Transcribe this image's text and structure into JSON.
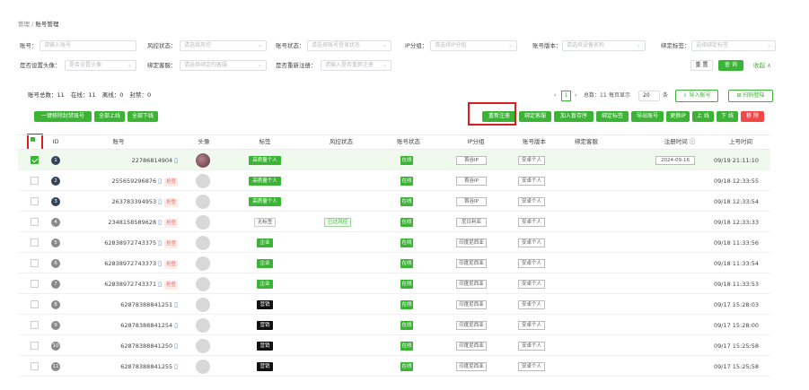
{
  "breadcrumb": {
    "parent": "管理",
    "sep": "/",
    "current": "账号管理"
  },
  "filters": {
    "account_label": "账号：",
    "account_placeholder": "请输入账号",
    "risk_label": "风控状态：",
    "risk_placeholder": "请选择风控",
    "acc_status_label": "账号状态：",
    "acc_status_placeholder": "请选择账号登录状态",
    "ip_label": "IP分组：",
    "ip_placeholder": "请选择IP分组",
    "version_label": "账号版本：",
    "version_placeholder": "请选择设备名称",
    "bind_tag_label": "绑定标签：",
    "bind_tag_placeholder": "选择绑定标签",
    "avatar_label": "是否设置头像：",
    "avatar_placeholder": "是否设置头像",
    "bind_cs_label": "绑定客服：",
    "bind_cs_placeholder": "请选择绑定的客服",
    "reregister_label": "是否重新注册：",
    "reregister_placeholder": "请输入是否重新注册",
    "reset": "重 置",
    "query": "查 询",
    "collapse": "收起 ∧"
  },
  "stats": {
    "total": "账号总数：11",
    "online": "在线：11",
    "offline": "离线：0",
    "banned": "封禁：0"
  },
  "pagination": {
    "prev": "‹",
    "page": "1",
    "next": "›",
    "total": "总数：11",
    "per_page_label": "每页显示",
    "per_page": "20",
    "unit": "条"
  },
  "top_actions": {
    "import": "导入账号",
    "sweep": "扫码登陆"
  },
  "left_actions": {
    "remove_banned": "一键移除封禁账号",
    "all_online": "全部上线",
    "all_offline": "全部下线"
  },
  "right_actions": {
    "reregister": "重新注册",
    "bind_cs": "绑定客服",
    "add_kw": "加入暂存序",
    "bind_tag": "绑定标签",
    "export": "导出账号",
    "change_ip": "更换IP",
    "online": "上 线",
    "offline": "下 线",
    "remove": "移 除"
  },
  "columns": {
    "id": "ID",
    "account": "账号",
    "avatar": "头像",
    "tag": "标签",
    "risk": "风控状态",
    "status": "账号状态",
    "ip": "IP分组",
    "version": "账号版本",
    "cs": "绑定客服",
    "regtime": "注册时间 ⓘ",
    "lastlogin": "上号时间"
  },
  "rows": [
    {
      "id": "1",
      "account": "22786814904",
      "warn": "",
      "tag": "高质量个人",
      "risk": "",
      "status": "在线",
      "ip": "首谷IP",
      "version": "安卓个人",
      "date": "2024-09-16",
      "time": "09/19 21:11:10"
    },
    {
      "id": "2",
      "account": "255659296876",
      "warn": "抢登",
      "tag": "高质量个人",
      "risk": "",
      "status": "在线",
      "ip": "首谷IP",
      "version": "安卓个人",
      "date": "",
      "time": "09/18 12:33:55"
    },
    {
      "id": "3",
      "account": "263783394953",
      "warn": "抢登",
      "tag": "高质量个人",
      "risk": "",
      "status": "在线",
      "ip": "首谷IP",
      "version": "安卓个人",
      "date": "",
      "time": "09/18 12:33:54"
    },
    {
      "id": "4",
      "account": "2348158589628",
      "warn": "抢登",
      "tag": "无标签",
      "risk": "已过风控",
      "status": "在线",
      "ip": "尼日利亚",
      "version": "安卓个人",
      "date": "",
      "time": "09/18 12:33:33"
    },
    {
      "id": "5",
      "account": "62838972743375",
      "warn": "抢登",
      "tag": "企业",
      "risk": "",
      "status": "在线",
      "ip": "印度尼西亚",
      "version": "安卓个人",
      "date": "",
      "time": "09/18 11:33:56"
    },
    {
      "id": "6",
      "account": "62838972743373",
      "warn": "抢登",
      "tag": "企业",
      "risk": "",
      "status": "在线",
      "ip": "印度尼西亚",
      "version": "安卓个人",
      "date": "",
      "time": "09/18 11:33:54"
    },
    {
      "id": "7",
      "account": "62838972743371",
      "warn": "抢登",
      "tag": "企业",
      "risk": "",
      "status": "在线",
      "ip": "印度尼西亚",
      "version": "安卓个人",
      "date": "",
      "time": "09/18 11:33:53"
    },
    {
      "id": "8",
      "account": "62878388841251",
      "warn": "",
      "tag": "营销",
      "risk": "",
      "status": "在线",
      "ip": "印度尼西亚",
      "version": "安卓个人",
      "date": "",
      "time": "09/17 15:28:03"
    },
    {
      "id": "9",
      "account": "62878388841254",
      "warn": "",
      "tag": "营销",
      "risk": "",
      "status": "在线",
      "ip": "印度尼西亚",
      "version": "安卓个人",
      "date": "",
      "time": "09/17 15:28:00"
    },
    {
      "id": "10",
      "account": "62878388841250",
      "warn": "",
      "tag": "营销",
      "risk": "",
      "status": "在线",
      "ip": "印度尼西亚",
      "version": "安卓个人",
      "date": "",
      "time": "09/17 15:25:58"
    },
    {
      "id": "11",
      "account": "62878388841255",
      "warn": "",
      "tag": "营销",
      "risk": "",
      "status": "在线",
      "ip": "印度尼西亚",
      "version": "安卓个人",
      "date": "",
      "time": "09/17 15:25:58"
    }
  ],
  "colors": {
    "accent": "#3bb335",
    "danger": "#f04848",
    "highlight_box": "#d81e1e"
  }
}
